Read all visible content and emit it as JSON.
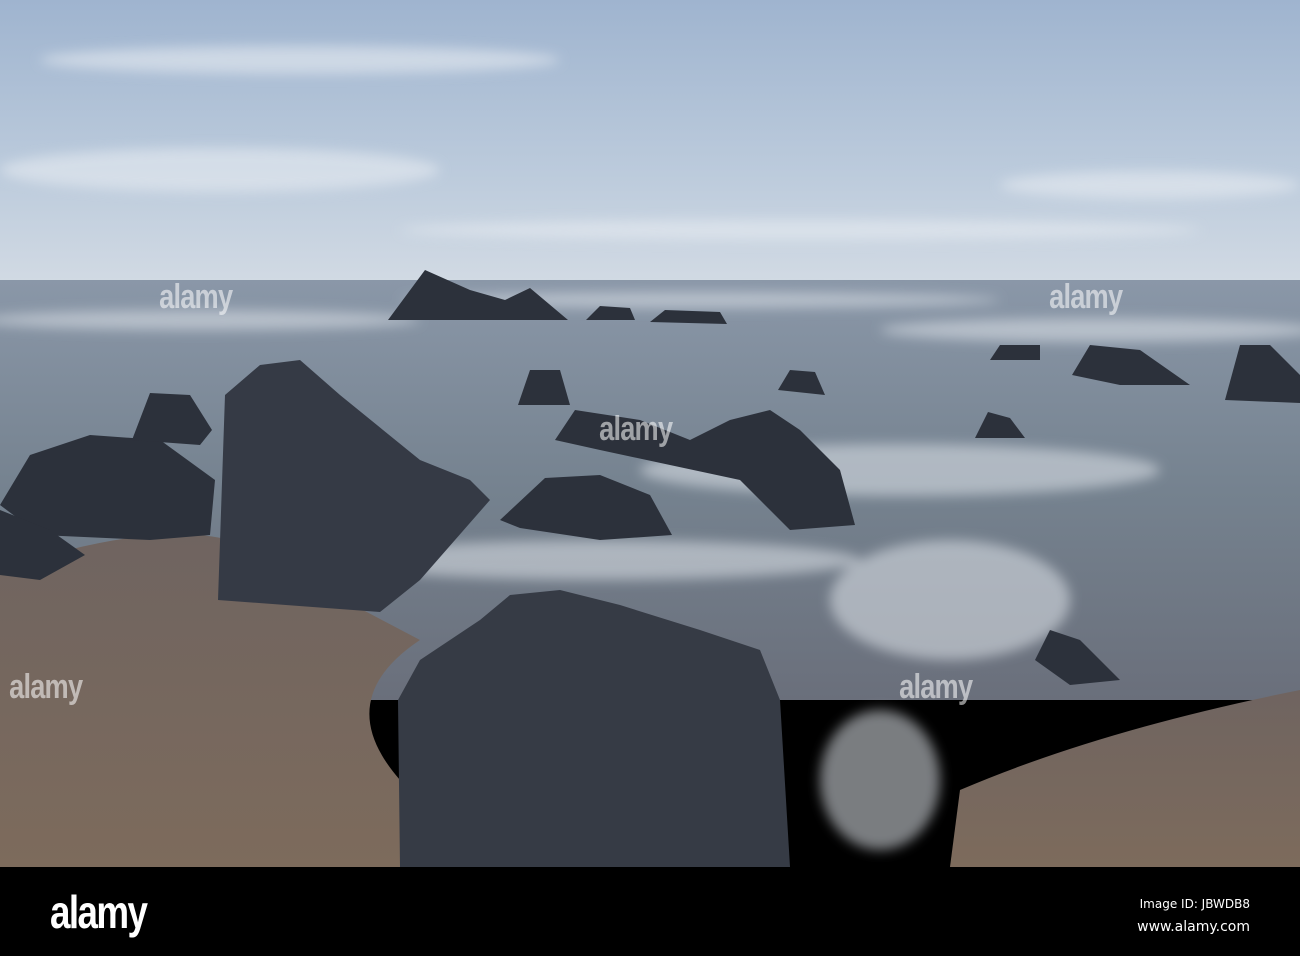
{
  "photo": {
    "subject": "rocky-beach-long-exposure",
    "colors": {
      "sky_top": "#a6bad3",
      "sky_horizon": "#d3dbe4",
      "sea": "#6e7a8c",
      "sand": "#7a6a5d",
      "rock": "#2c313b"
    }
  },
  "watermark": {
    "text": "alamy"
  },
  "footer": {
    "logo": "alamy",
    "image_id": "Image ID: JBWDB8",
    "website": "www.alamy.com"
  }
}
